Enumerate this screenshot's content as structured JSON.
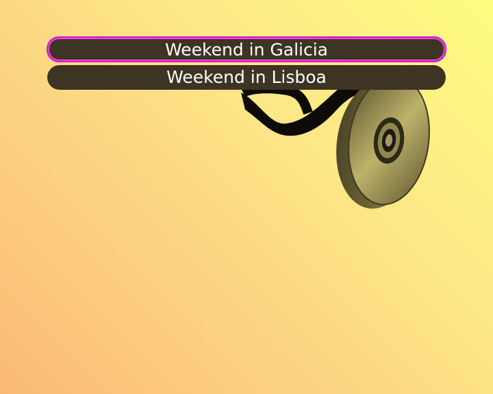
{
  "menu": {
    "items": [
      {
        "label": "Weekend in Galicia",
        "selected": true
      },
      {
        "label": "Weekend in Lisboa",
        "selected": false
      }
    ]
  },
  "colors": {
    "background_top_right": "#fefd80",
    "background_bottom_left": "#fbba74",
    "menu_item_background": "#3d3423",
    "menu_text": "#ffffff",
    "selection_border": "#e31ad7"
  },
  "decoration": {
    "icon": "film-reel-icon"
  }
}
